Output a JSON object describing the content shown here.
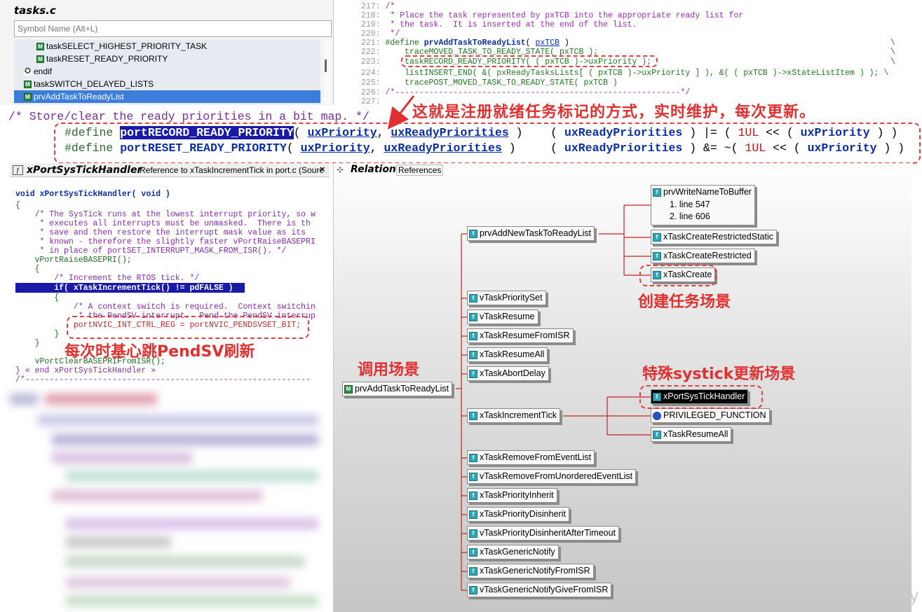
{
  "symbol_panel": {
    "title": "tasks.c",
    "search_placeholder": "Symbol Name (Alt+L)",
    "items": [
      {
        "label": "taskSELECT_HIGHEST_PRIORITY_TASK",
        "icon": "macro-icon"
      },
      {
        "label": "taskRESET_READY_PRIORITY",
        "icon": "macro-icon"
      },
      {
        "label": "endif",
        "icon": "preprocessor-icon"
      },
      {
        "label": "taskSWITCH_DELAYED_LISTS",
        "icon": "macro-icon"
      },
      {
        "label": "prvAddTaskToReadyList",
        "icon": "macro-icon",
        "selected": true
      }
    ]
  },
  "top_code": {
    "lines": [
      {
        "num": "217:",
        "text": "/*"
      },
      {
        "num": "218:",
        "text": " * Place the task represented by pxTCB into the appropriate ready list for"
      },
      {
        "num": "219:",
        "text": " * the task.  It is inserted at the end of the list."
      },
      {
        "num": "220:",
        "text": " */"
      },
      {
        "num": "221:",
        "define": "#define",
        "name": "prvAddTaskToReadyList",
        "open": "( ",
        "param": "pxTCB",
        "close": " )",
        "cont": "\\"
      },
      {
        "num": "222:",
        "text": "    traceMOVED_TASK_TO_READY_STATE( pxTCB );",
        "cont": "\\"
      },
      {
        "num": "223:",
        "text": "    taskRECORD_READY_PRIORITY( ( pxTCB )->uxPriority );",
        "cont": "\\"
      },
      {
        "num": "224:",
        "text": "    listINSERT_END( &( pxReadyTasksLists[ ( pxTCB )->uxPriority ] ), &( ( pxTCB )->xStateListItem ) ); \\"
      },
      {
        "num": "225:",
        "text": "    tracePOST_MOVED_TASK_TO_READY_STATE( pxTCB )"
      },
      {
        "num": "226:",
        "text": "/*-----------------------------------------------------------*/"
      },
      {
        "num": "227:",
        "text": ""
      }
    ]
  },
  "annotation_main": "这就是注册就绪任务标记的方式，实时维护，每次更新。",
  "store_comment": "/* Store/clear the ready priorities in a bit map. */",
  "defines": [
    {
      "kw": "#define",
      "name": "portRECORD_READY_PRIORITY",
      "p1": "uxPriority",
      "p2": "uxReadyPriorities",
      "body_a": "uxReadyPriorities",
      "op": " ) |= ( ",
      "num": "1UL",
      "shift": " << ( ",
      "body_b": "uxPriority",
      "end": " ) )"
    },
    {
      "kw": "#define",
      "name": "portRESET_READY_PRIORITY",
      "p1": "uxPriority",
      "p2": "uxReadyPriorities",
      "body_a": "uxReadyPriorities",
      "op": " ) &= ~( ",
      "num": "1UL",
      "shift": " << ( ",
      "body_b": "uxPriority",
      "end": " ) )"
    }
  ],
  "left_pane": {
    "tab_title": "xPortSysTickHandler",
    "tab_subtitle": "Reference to xTaskIncrementTick in port.c (Sourc",
    "close": "×",
    "code": [
      {
        "text": "void xPortSysTickHandler( void )",
        "kind": "sig"
      },
      {
        "text": "{",
        "kind": "code"
      },
      {
        "text": "    /* The SysTick runs at the lowest interrupt priority, so w",
        "kind": "cmt"
      },
      {
        "text": "     * executes all interrupts must be unmasked.  There is th",
        "kind": "cmt"
      },
      {
        "text": "     * save and then restore the interrupt mask value as its ",
        "kind": "cmt"
      },
      {
        "text": "     * known - therefore the slightly faster vPortRaiseBASEPRI",
        "kind": "cmt"
      },
      {
        "text": "     * in place of portSET_INTERRUPT_MASK_FROM_ISR(). */",
        "kind": "cmt"
      },
      {
        "text": "    vPortRaiseBASEPRI();",
        "kind": "code"
      },
      {
        "text": "    {",
        "kind": "code"
      },
      {
        "text": "        /* Increment the RTOS tick. */",
        "kind": "cmt"
      },
      {
        "text": "        if( xTaskIncrementTick() != pdFALSE )",
        "kind": "hl"
      },
      {
        "text": "        {",
        "kind": "code"
      },
      {
        "text": "            /* A context switch is required.  Context switchin",
        "kind": "cmt"
      },
      {
        "text": "             * the PendSV interrupt.  Pend the PendSV interrup",
        "kind": "cmt"
      },
      {
        "text": "            portNVIC_INT_CTRL_REG = portNVIC_PENDSVSET_BIT;",
        "kind": "code"
      },
      {
        "text": "        }",
        "kind": "code"
      },
      {
        "text": "    }",
        "kind": "code"
      },
      {
        "text": "    vPortClearBASEPRIFromISR();",
        "kind": "code"
      },
      {
        "text": "} « end xPortSysTickHandler »",
        "kind": "cmt"
      },
      {
        "text": "/*-----------------------------------------------------------",
        "kind": "cmt"
      }
    ],
    "annotation": "每次时基心跳PendSV刷新"
  },
  "relation_pane": {
    "tab_title": "Relation",
    "tab_subtitle": "References",
    "root": "prvAddTaskToReadyList",
    "callers": [
      "prvAddNewTaskToReadyList",
      "vTaskPrioritySet",
      "vTaskResume",
      "xTaskResumeFromISR",
      "xTaskResumeAll",
      "xTaskAbortDelay",
      "xTaskIncrementTick",
      "xTaskRemoveFromEventList",
      "vTaskRemoveFromUnorderedEventList",
      "xTaskPriorityInherit",
      "xTaskPriorityDisinherit",
      "vTaskPriorityDisinheritAfterTimeout",
      "xTaskGenericNotify",
      "xTaskGenericNotifyFromISR",
      "vTaskGenericNotifyGiveFromISR"
    ],
    "new_task_callers": {
      "write_name": "prvWriteNameToBuffer",
      "write_lines": [
        "1. line 547",
        "2. line 606"
      ],
      "restricted_static": "xTaskCreateRestrictedStatic",
      "restricted": "xTaskCreateRestricted",
      "create": "xTaskCreate"
    },
    "tick_callers": {
      "systick": "xPortSysTickHandler",
      "privileged": "PRIVILEGED_FUNCTION",
      "resume_all": "xTaskResumeAll"
    },
    "annotations": {
      "create_scene": "创建任务场景",
      "call_scene": "调用场景",
      "systick_scene": "特殊systick更新场景"
    }
  },
  "watermark": "CSDN @Mapleay",
  "colors": {
    "accent_red": "#e03030",
    "selection_blue": "#1a1aa8"
  }
}
